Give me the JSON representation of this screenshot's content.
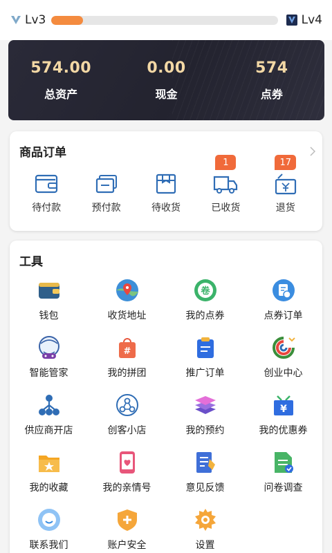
{
  "level": {
    "current": "Lv3",
    "next": "Lv4",
    "progress": 0.14
  },
  "assets": [
    {
      "value": "574.00",
      "label": "总资产"
    },
    {
      "value": "0.00",
      "label": "现金"
    },
    {
      "value": "574",
      "label": "点券"
    }
  ],
  "orders": {
    "title": "商品订单",
    "items": [
      {
        "label": "待付款",
        "icon": "wallet-icon",
        "badge": ""
      },
      {
        "label": "预付款",
        "icon": "prepay-card-icon",
        "badge": ""
      },
      {
        "label": "待收货",
        "icon": "box-icon",
        "badge": ""
      },
      {
        "label": "已收货",
        "icon": "truck-icon",
        "badge": "1"
      },
      {
        "label": "退货",
        "icon": "return-icon",
        "badge": "17"
      }
    ]
  },
  "tools": {
    "title": "工具",
    "items": [
      {
        "label": "钱包",
        "icon": "wallet-icon"
      },
      {
        "label": "收货地址",
        "icon": "map-pin-icon"
      },
      {
        "label": "我的点券",
        "icon": "coupon-icon"
      },
      {
        "label": "点券订单",
        "icon": "coupon-order-icon"
      },
      {
        "label": "智能管家",
        "icon": "robot-icon"
      },
      {
        "label": "我的拼团",
        "icon": "group-buy-icon"
      },
      {
        "label": "推广订单",
        "icon": "clipboard-icon"
      },
      {
        "label": "创业中心",
        "icon": "startup-icon"
      },
      {
        "label": "供应商开店",
        "icon": "network-icon"
      },
      {
        "label": "创客小店",
        "icon": "shop-network-icon"
      },
      {
        "label": "我的预约",
        "icon": "layers-icon"
      },
      {
        "label": "我的优惠券",
        "icon": "discount-icon"
      },
      {
        "label": "我的收藏",
        "icon": "favorite-folder-icon"
      },
      {
        "label": "我的亲情号",
        "icon": "phone-heart-icon"
      },
      {
        "label": "意见反馈",
        "icon": "feedback-icon"
      },
      {
        "label": "问卷调查",
        "icon": "survey-icon"
      },
      {
        "label": "联系我们",
        "icon": "chat-icon"
      },
      {
        "label": "账户安全",
        "icon": "shield-icon"
      },
      {
        "label": "设置",
        "icon": "gear-icon"
      }
    ]
  },
  "colors": {
    "accent": "#f48b3f",
    "badge": "#f06a3a",
    "asset_value": "#f3d8a5",
    "icon_blue": "#2f6db5"
  }
}
